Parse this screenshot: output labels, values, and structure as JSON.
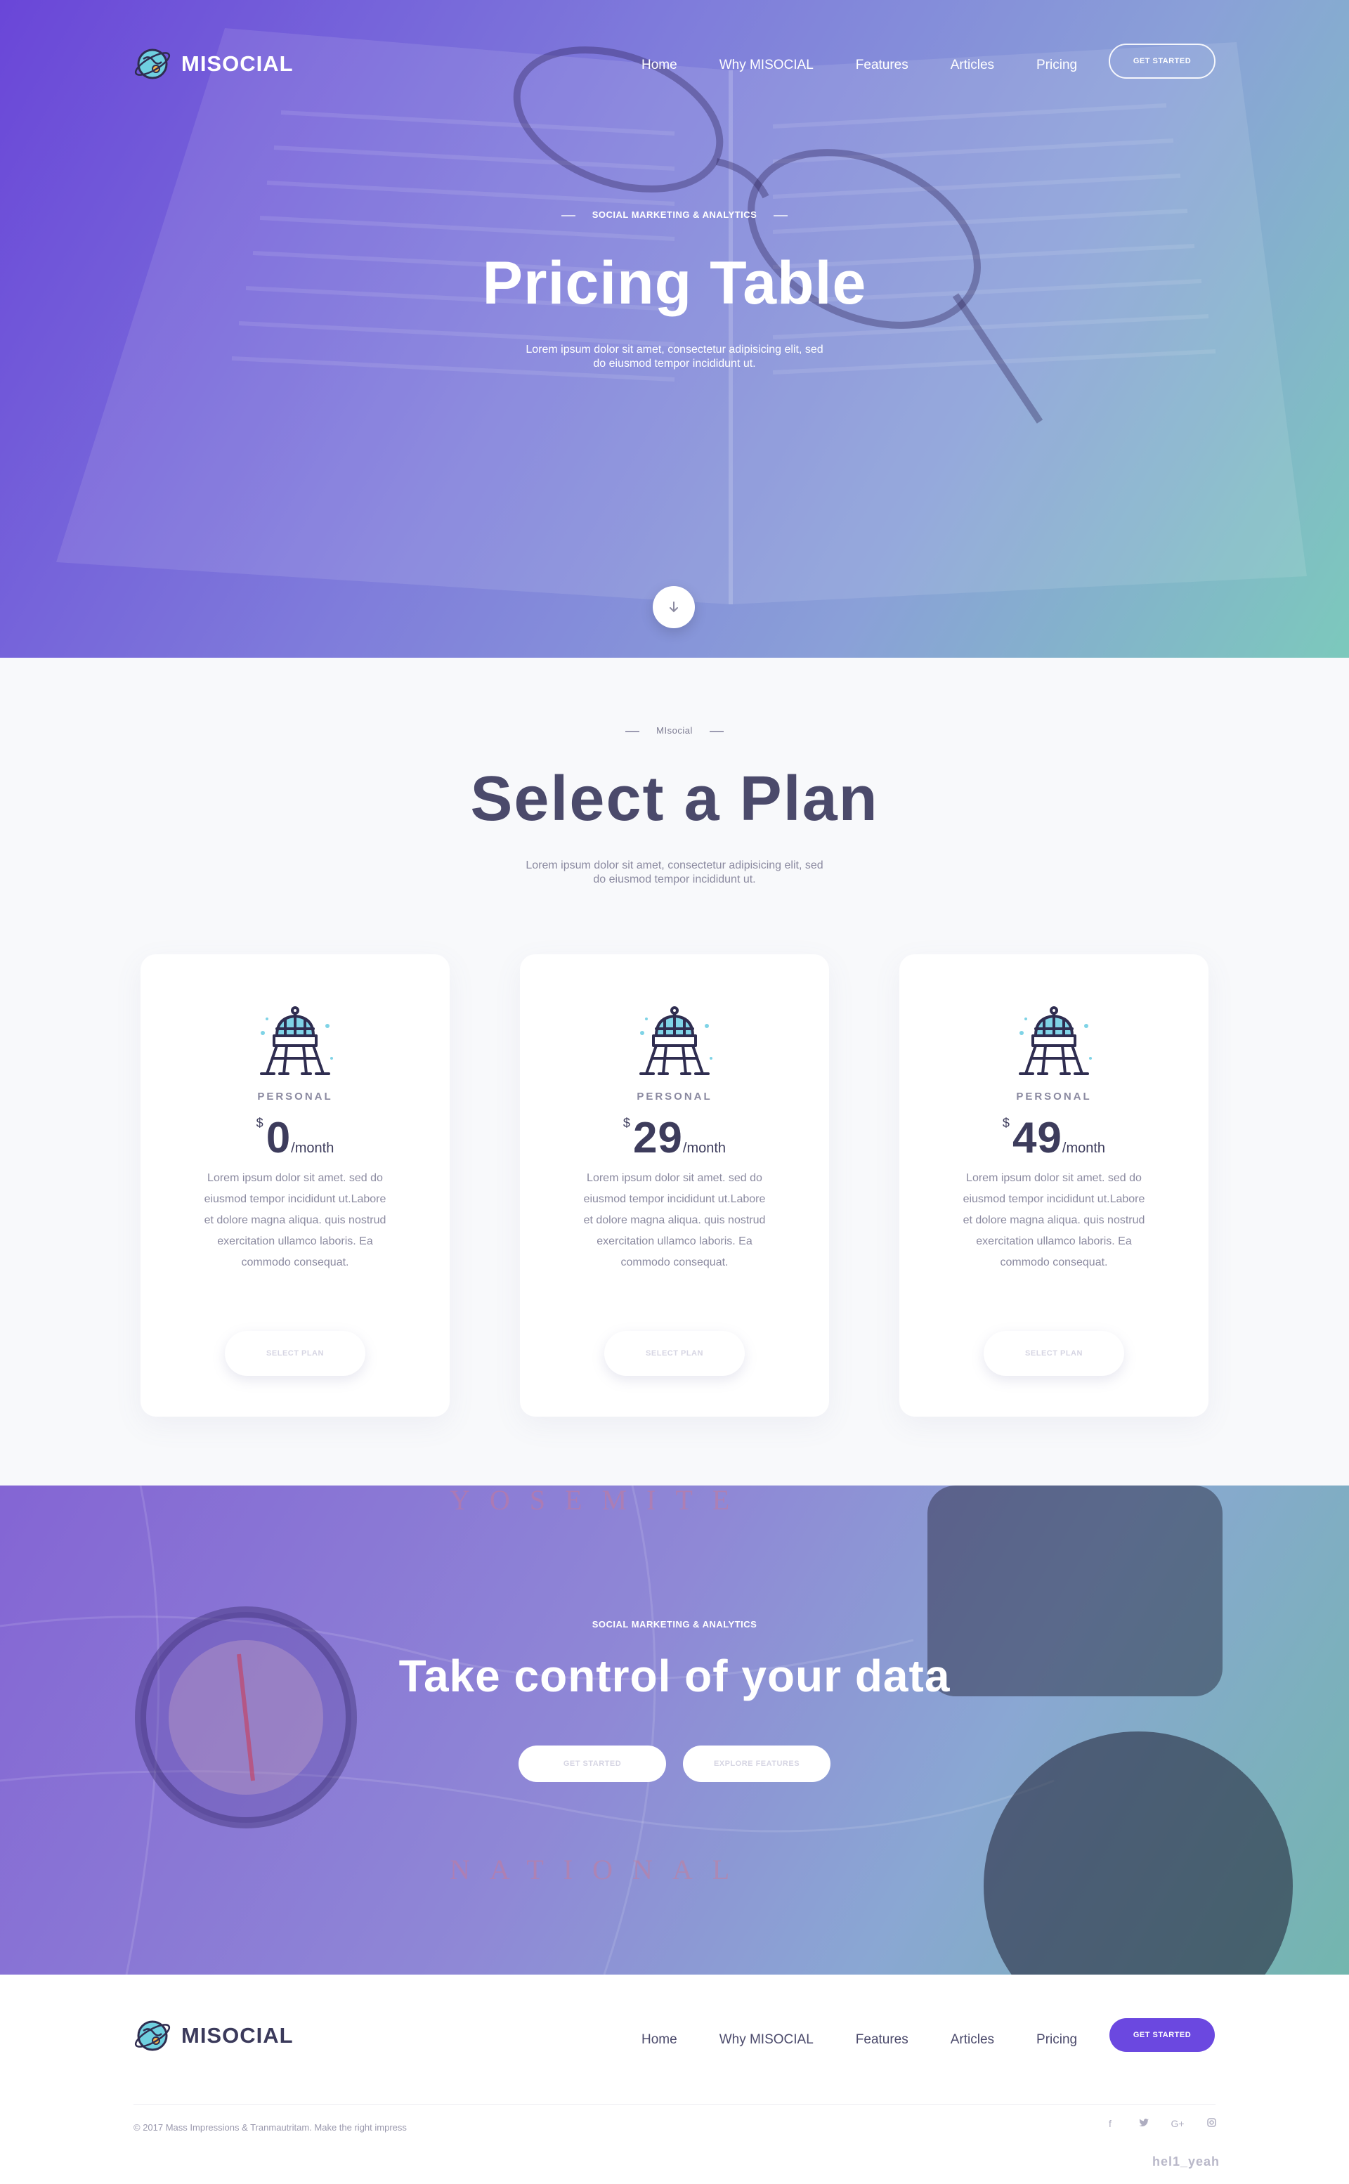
{
  "brand": {
    "name": "MISOCIAL"
  },
  "nav": {
    "items": [
      "Home",
      "Why MISOCIAL",
      "Features",
      "Articles",
      "Pricing"
    ],
    "cta_label": "GET STARTED"
  },
  "hero": {
    "eyebrow": "SOCIAL MARKETING & ANALYTICS",
    "title": "Pricing Table",
    "subtitle": "Lorem ipsum dolor sit amet, consectetur adipisicing elit, sed do eiusmod tempor incididunt ut."
  },
  "plans_section": {
    "eyebrow": "MIsocial",
    "title": "Select a Plan",
    "subtitle": "Lorem ipsum dolor sit amet, consectetur adipisicing elit, sed do eiusmod tempor incididunt ut."
  },
  "plans": [
    {
      "tier": "PERSONAL",
      "currency": "$",
      "amount": "0",
      "period": "/month",
      "description": "Lorem ipsum dolor sit amet. sed do eiusmod tempor incididunt ut.Labore et dolore magna aliqua. quis nostrud exercitation ullamco laboris. Ea commodo consequat.",
      "button": "SELECT PLAN"
    },
    {
      "tier": "PERSONAL",
      "currency": "$",
      "amount": "29",
      "period": "/month",
      "description": "Lorem ipsum dolor sit amet. sed do eiusmod tempor incididunt ut.Labore et dolore magna aliqua. quis nostrud exercitation ullamco laboris. Ea commodo consequat.",
      "button": "SELECT PLAN"
    },
    {
      "tier": "PERSONAL",
      "currency": "$",
      "amount": "49",
      "period": "/month",
      "description": "Lorem ipsum dolor sit amet. sed do eiusmod tempor incididunt ut.Labore et dolore magna aliqua. quis nostrud exercitation ullamco laboris. Ea commodo consequat.",
      "button": "SELECT PLAN"
    }
  ],
  "cta": {
    "eyebrow": "SOCIAL MARKETING & ANALYTICS",
    "title": "Take control of your data",
    "primary_button": "GET STARTED",
    "secondary_button": "EXPLORE FEATURES"
  },
  "footer": {
    "copyright": "© 2017 Mass Impressions & Tranmautritam. Make the right impress",
    "social_icons": [
      "facebook-icon",
      "twitter-icon",
      "google-plus-icon",
      "instagram-icon"
    ],
    "watermark": "hel1_yeah"
  },
  "colors": {
    "accent": "#6b48e0",
    "heading": "#4b4a6b",
    "muted": "#8b8aa0"
  }
}
